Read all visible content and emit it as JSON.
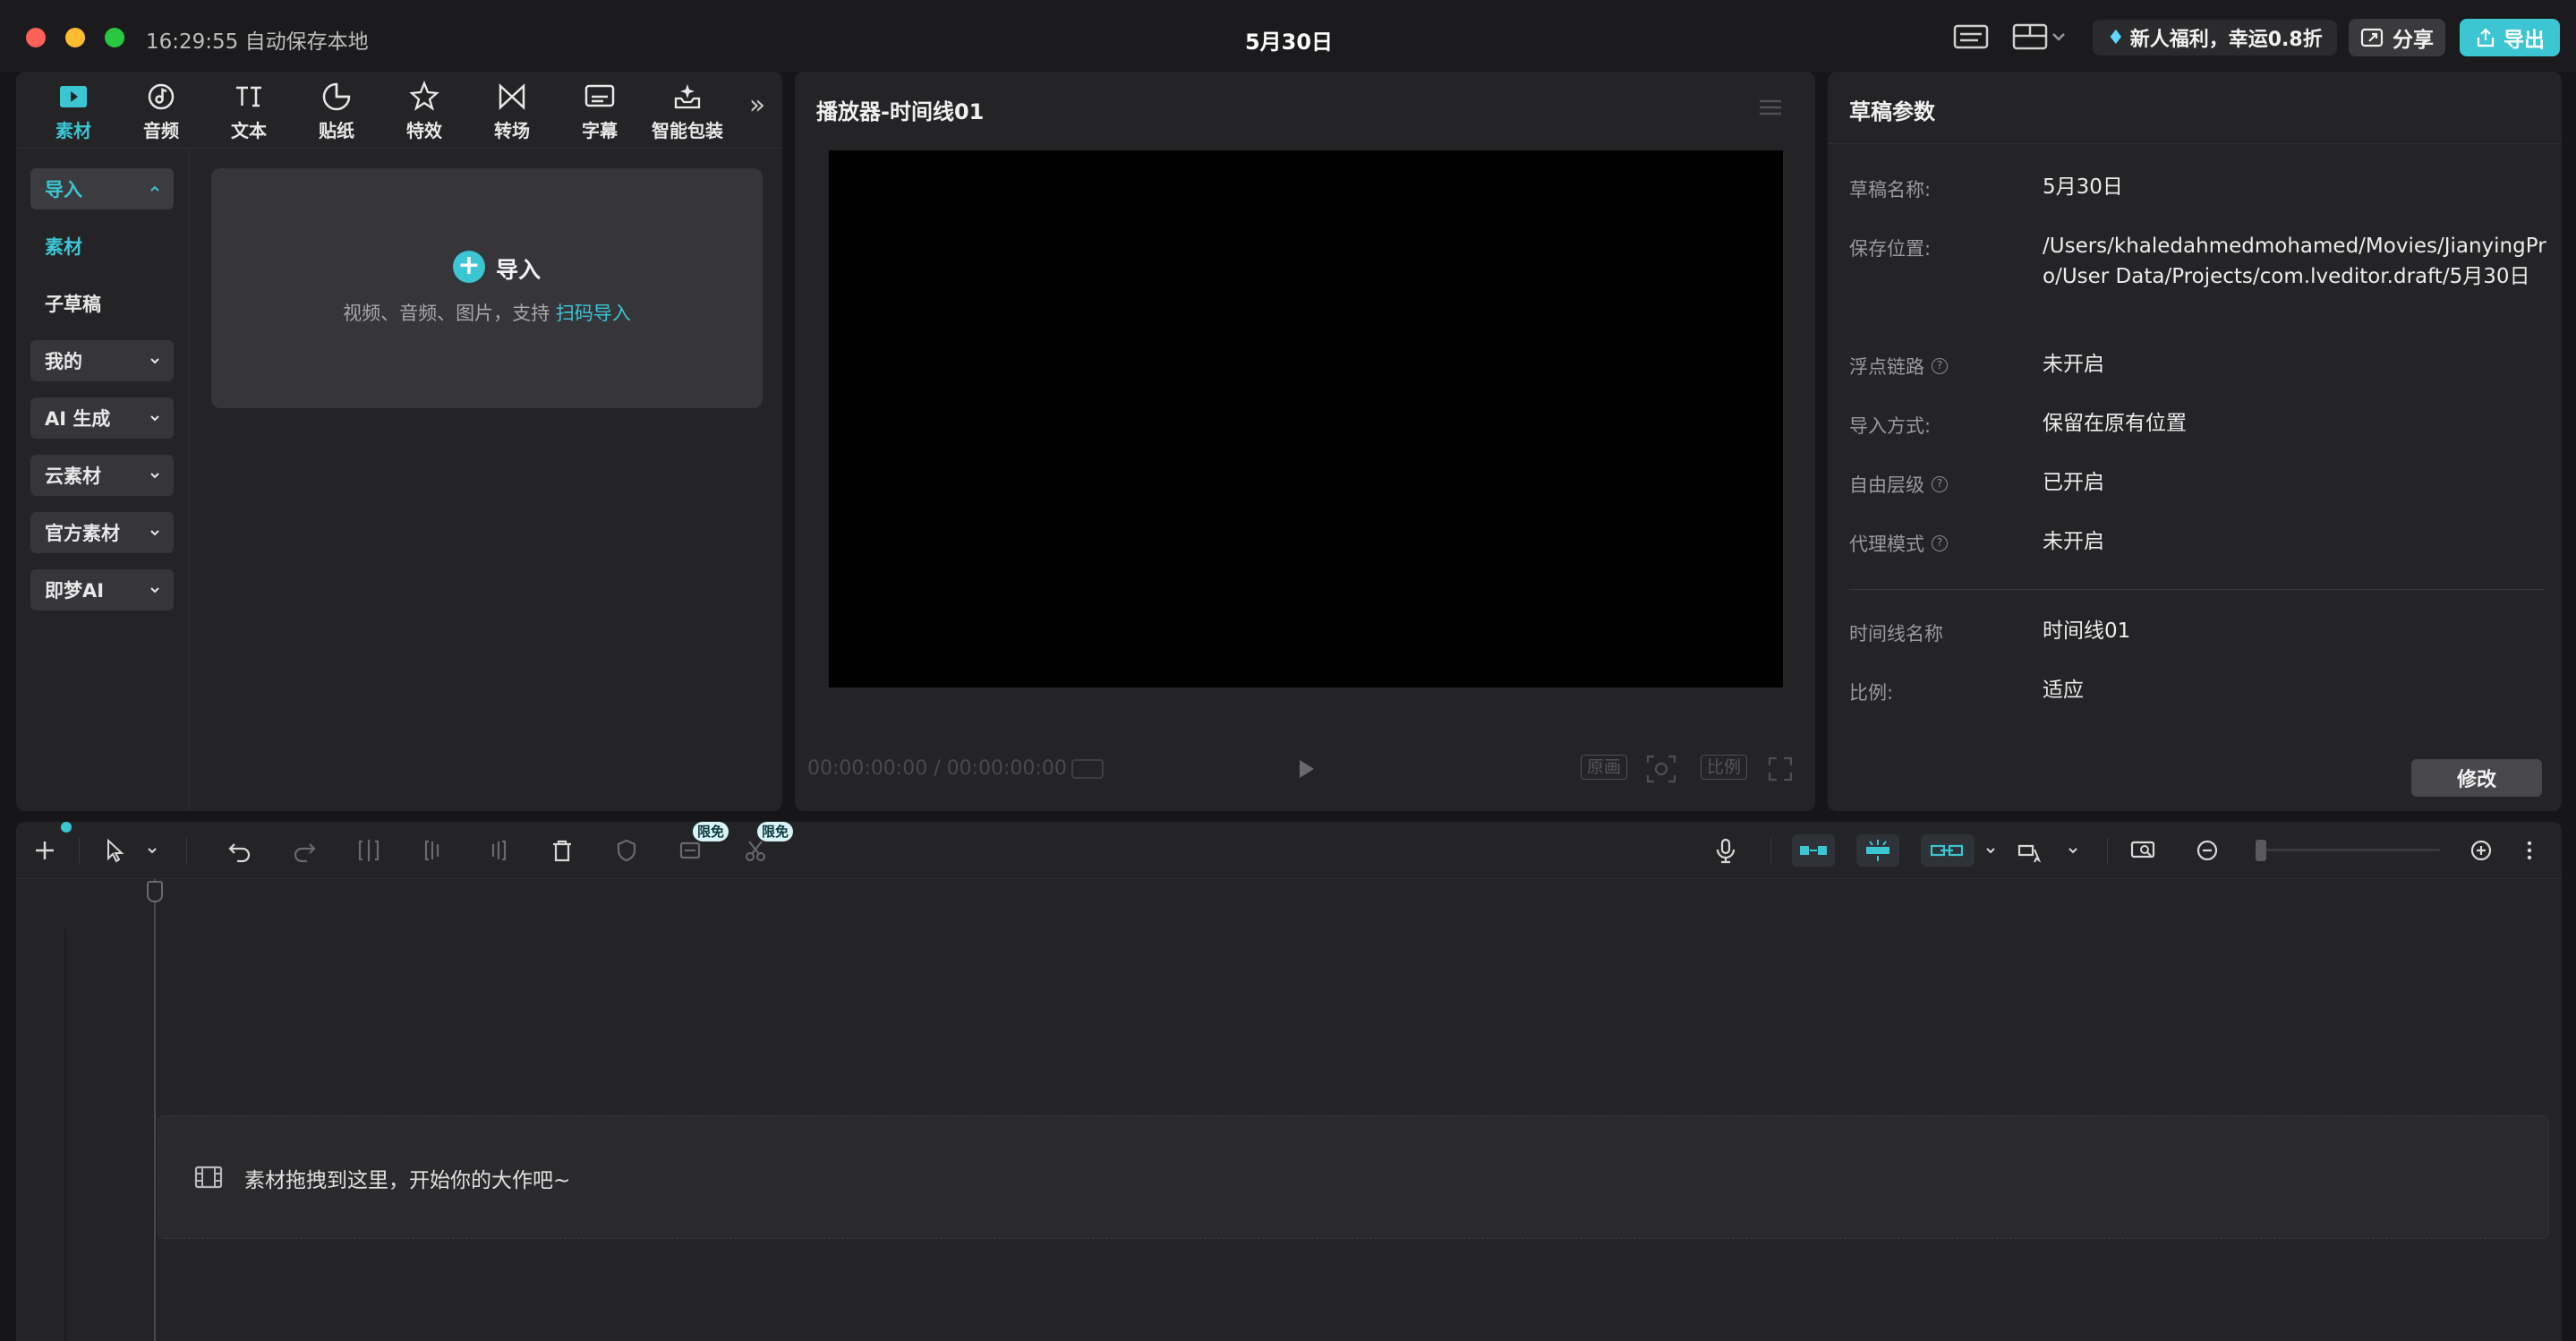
{
  "titlebar": {
    "autosave": "16:29:55 自动保存本地",
    "project_title": "5月30日",
    "promo": "新人福利，幸运0.8折",
    "share_label": "分享",
    "export_label": "导出"
  },
  "categories": [
    {
      "label": "素材",
      "icon": "media-icon",
      "active": true
    },
    {
      "label": "音频",
      "icon": "audio-icon"
    },
    {
      "label": "文本",
      "icon": "text-icon"
    },
    {
      "label": "贴纸",
      "icon": "sticker-icon"
    },
    {
      "label": "特效",
      "icon": "effects-icon"
    },
    {
      "label": "转场",
      "icon": "transition-icon"
    },
    {
      "label": "字幕",
      "icon": "subtitle-icon"
    },
    {
      "label": "智能包装",
      "icon": "smart-pack-icon"
    }
  ],
  "left_nav": {
    "import": "导入",
    "media": "素材",
    "sub_draft": "子草稿",
    "mine": "我的",
    "ai_gen": "AI 生成",
    "cloud": "云素材",
    "official": "官方素材",
    "jimeng": "即梦AI"
  },
  "import_box": {
    "title": "导入",
    "desc": "视频、音频、图片，支持 ",
    "link": "扫码导入"
  },
  "player": {
    "title": "播放器-时间线01",
    "time": "00:00:00:00 / 00:00:00:00",
    "original_label": "原画",
    "ratio_label": "比例"
  },
  "draft": {
    "title": "草稿参数",
    "rows": [
      {
        "label": "草稿名称:",
        "value": "5月30日"
      },
      {
        "label": "保存位置:",
        "value": "/Users/khaledahmedmohamed/Movies/JianyingPro/User Data/Projects/com.lveditor.draft/5月30日"
      },
      {
        "label": "浮点链路",
        "value": "未开启"
      },
      {
        "label": "导入方式:",
        "value": "保留在原有位置"
      },
      {
        "label": "自由层级",
        "value": "已开启"
      },
      {
        "label": "代理模式",
        "value": "未开启"
      },
      {
        "label": "时间线名称",
        "value": "时间线01"
      },
      {
        "label": "比例:",
        "value": "适应"
      }
    ],
    "modify_label": "修改"
  },
  "timeline": {
    "badge1": "限免",
    "badge2": "限免",
    "drop_text": "素材拖拽到这里，开始你的大作吧~"
  },
  "colors": {
    "accent": "#3cc5d3",
    "background": "#161618",
    "panel": "#242427"
  }
}
